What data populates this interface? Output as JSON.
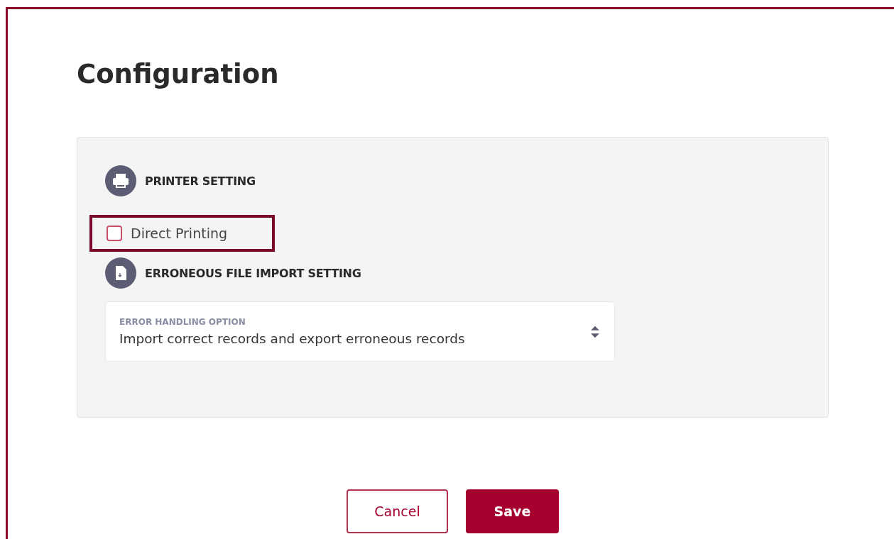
{
  "title": "Configuration",
  "sections": [
    {
      "kind": "printer",
      "heading": "PRINTER SETTING",
      "options": [
        {
          "label": "Direct Printing",
          "checked": false,
          "highlighted": true
        }
      ]
    },
    {
      "kind": "file",
      "heading": "ERRONEOUS FILE IMPORT SETTING",
      "select": {
        "label": "ERROR HANDLING OPTION",
        "value": "Import correct records and export erroneous records"
      }
    }
  ],
  "buttons": [
    {
      "label": "Cancel",
      "kind": "secondary"
    },
    {
      "label": "Save",
      "kind": "primary"
    }
  ]
}
